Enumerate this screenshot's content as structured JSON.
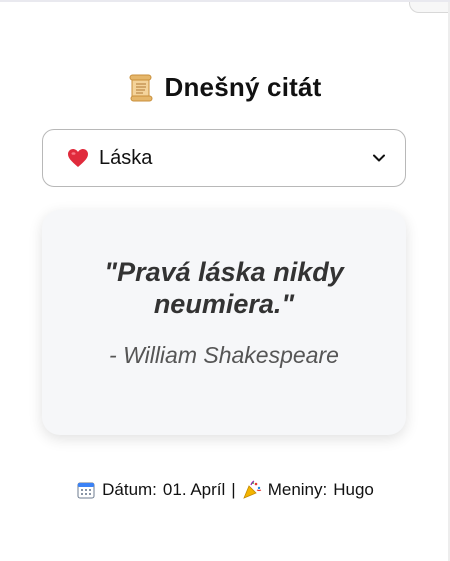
{
  "header": {
    "title": "Dnešný citát",
    "icon": "scroll-icon"
  },
  "category_select": {
    "selected_label": "Láska",
    "icon": "heart-icon"
  },
  "quote": {
    "text": "\"Pravá láska nikdy neumiera.\"",
    "author": "- William Shakespeare"
  },
  "footer": {
    "date_label": "Dátum:",
    "date_value": "01. Apríl",
    "separator": "|",
    "nameday_label": "Meniny:",
    "nameday_value": "Hugo",
    "date_icon": "calendar-icon",
    "nameday_icon": "party-popper-icon"
  },
  "colors": {
    "card_bg": "#f6f7f9",
    "border": "#b8b8b8",
    "heart": "#e02b3c",
    "scroll": "#f1c27d"
  }
}
